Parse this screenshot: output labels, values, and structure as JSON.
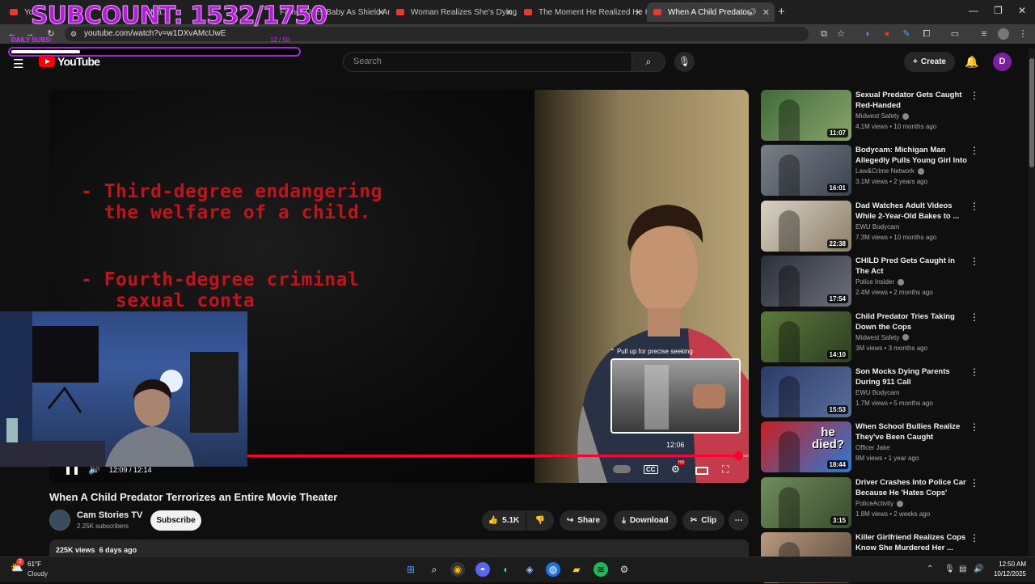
{
  "browser": {
    "tabs": [
      {
        "label": "You"
      },
      {
        "label": "Ma..."
      },
      {
        "label": "Father Uses Baby As Shield And"
      },
      {
        "label": "Woman Realizes She's Dying At"
      },
      {
        "label": "The Moment He Realized He Ki"
      },
      {
        "label": "When A Child Predator Terr"
      }
    ],
    "url": "youtube.com/watch?v=w1DXvAMcUwE"
  },
  "overlay": {
    "subcount": "SUBCOUNT: 1532/1750",
    "daily_label": "DAILY SUBS:",
    "daily_progress": "12 / 50",
    "daily_fraction": 0.24
  },
  "header": {
    "logo_text": "YouTube",
    "search_placeholder": "Search",
    "create_label": "Create",
    "avatar_letter": "D"
  },
  "player": {
    "onscreen_text_1": "- Third-degree endangering\n  the welfare of a child.",
    "onscreen_text_2": "- Fourth-degree criminal\n   sexual conta",
    "seek_hint": "Pull up for precise seeking",
    "seek_time": "12:06",
    "current_time": "12:09",
    "separator": " / ",
    "duration": "12:14",
    "progress_fraction": 0.985,
    "hover_fraction": 0.96,
    "cc_label": "CC",
    "hd_badge": "HD"
  },
  "video": {
    "title": "When A Child Predator Terrorizes an Entire Movie Theater",
    "channel": "Cam Stories TV",
    "subscribers": "2.25K subscribers",
    "subscribe_label": "Subscribe",
    "likes": "5.1K",
    "share_label": "Share",
    "download_label": "Download",
    "clip_label": "Clip",
    "views": "225K views",
    "age": "6 days ago"
  },
  "recommendations": [
    {
      "title": "Sexual Predator Gets Caught Red-Handed",
      "channel": "Midwest Safety",
      "verified": true,
      "meta": "4.1M views • 10 months ago",
      "duration": "11:07"
    },
    {
      "title": "Bodycam: Michigan Man Allegedly Pulls Young Girl Into ...",
      "channel": "Law&Crime Network",
      "verified": true,
      "meta": "3.1M views • 2 years ago",
      "duration": "16:01"
    },
    {
      "title": "Dad Watches Adult Videos While 2-Year-Old Bakes to ...",
      "channel": "EWU Bodycam",
      "verified": false,
      "meta": "7.3M views • 10 months ago",
      "duration": "22:38"
    },
    {
      "title": "CHILD Pred Gets Caught in The Act",
      "channel": "Police Insider",
      "verified": true,
      "meta": "2.4M views • 2 months ago",
      "duration": "17:54"
    },
    {
      "title": "Child Predator Tries Taking Down the Cops",
      "channel": "Midwest Safety",
      "verified": true,
      "meta": "3M views • 3 months ago",
      "duration": "14:10"
    },
    {
      "title": "Son Mocks Dying Parents During 911 Call",
      "channel": "EWU Bodycam",
      "verified": false,
      "meta": "1.7M views • 5 months ago",
      "duration": "15:53"
    },
    {
      "title": "When School Bullies Realize They've Been Caught",
      "channel": "Officer Jake",
      "verified": false,
      "meta": "8M views • 1 year ago",
      "duration": "18:44",
      "thumb_text": "he died?"
    },
    {
      "title": "Driver Crashes Into Police Car Because He 'Hates Cops'",
      "channel": "PoliceActivity",
      "verified": true,
      "meta": "1.8M views • 2 weeks ago",
      "duration": "3:15"
    },
    {
      "title": "Killer Girlfriend Realizes Cops Know She Murdered Her ...",
      "channel": "",
      "verified": false,
      "meta": "",
      "duration": ""
    }
  ],
  "taskbar": {
    "temperature": "61°F",
    "weather": "Cloudy",
    "weather_badge": "2",
    "time": "12:50 AM",
    "date": "10/12/2025"
  },
  "colors": {
    "accent": "#ff0033",
    "overlay_purple": "#b21ed6",
    "avatar": "#7b1fa2"
  }
}
